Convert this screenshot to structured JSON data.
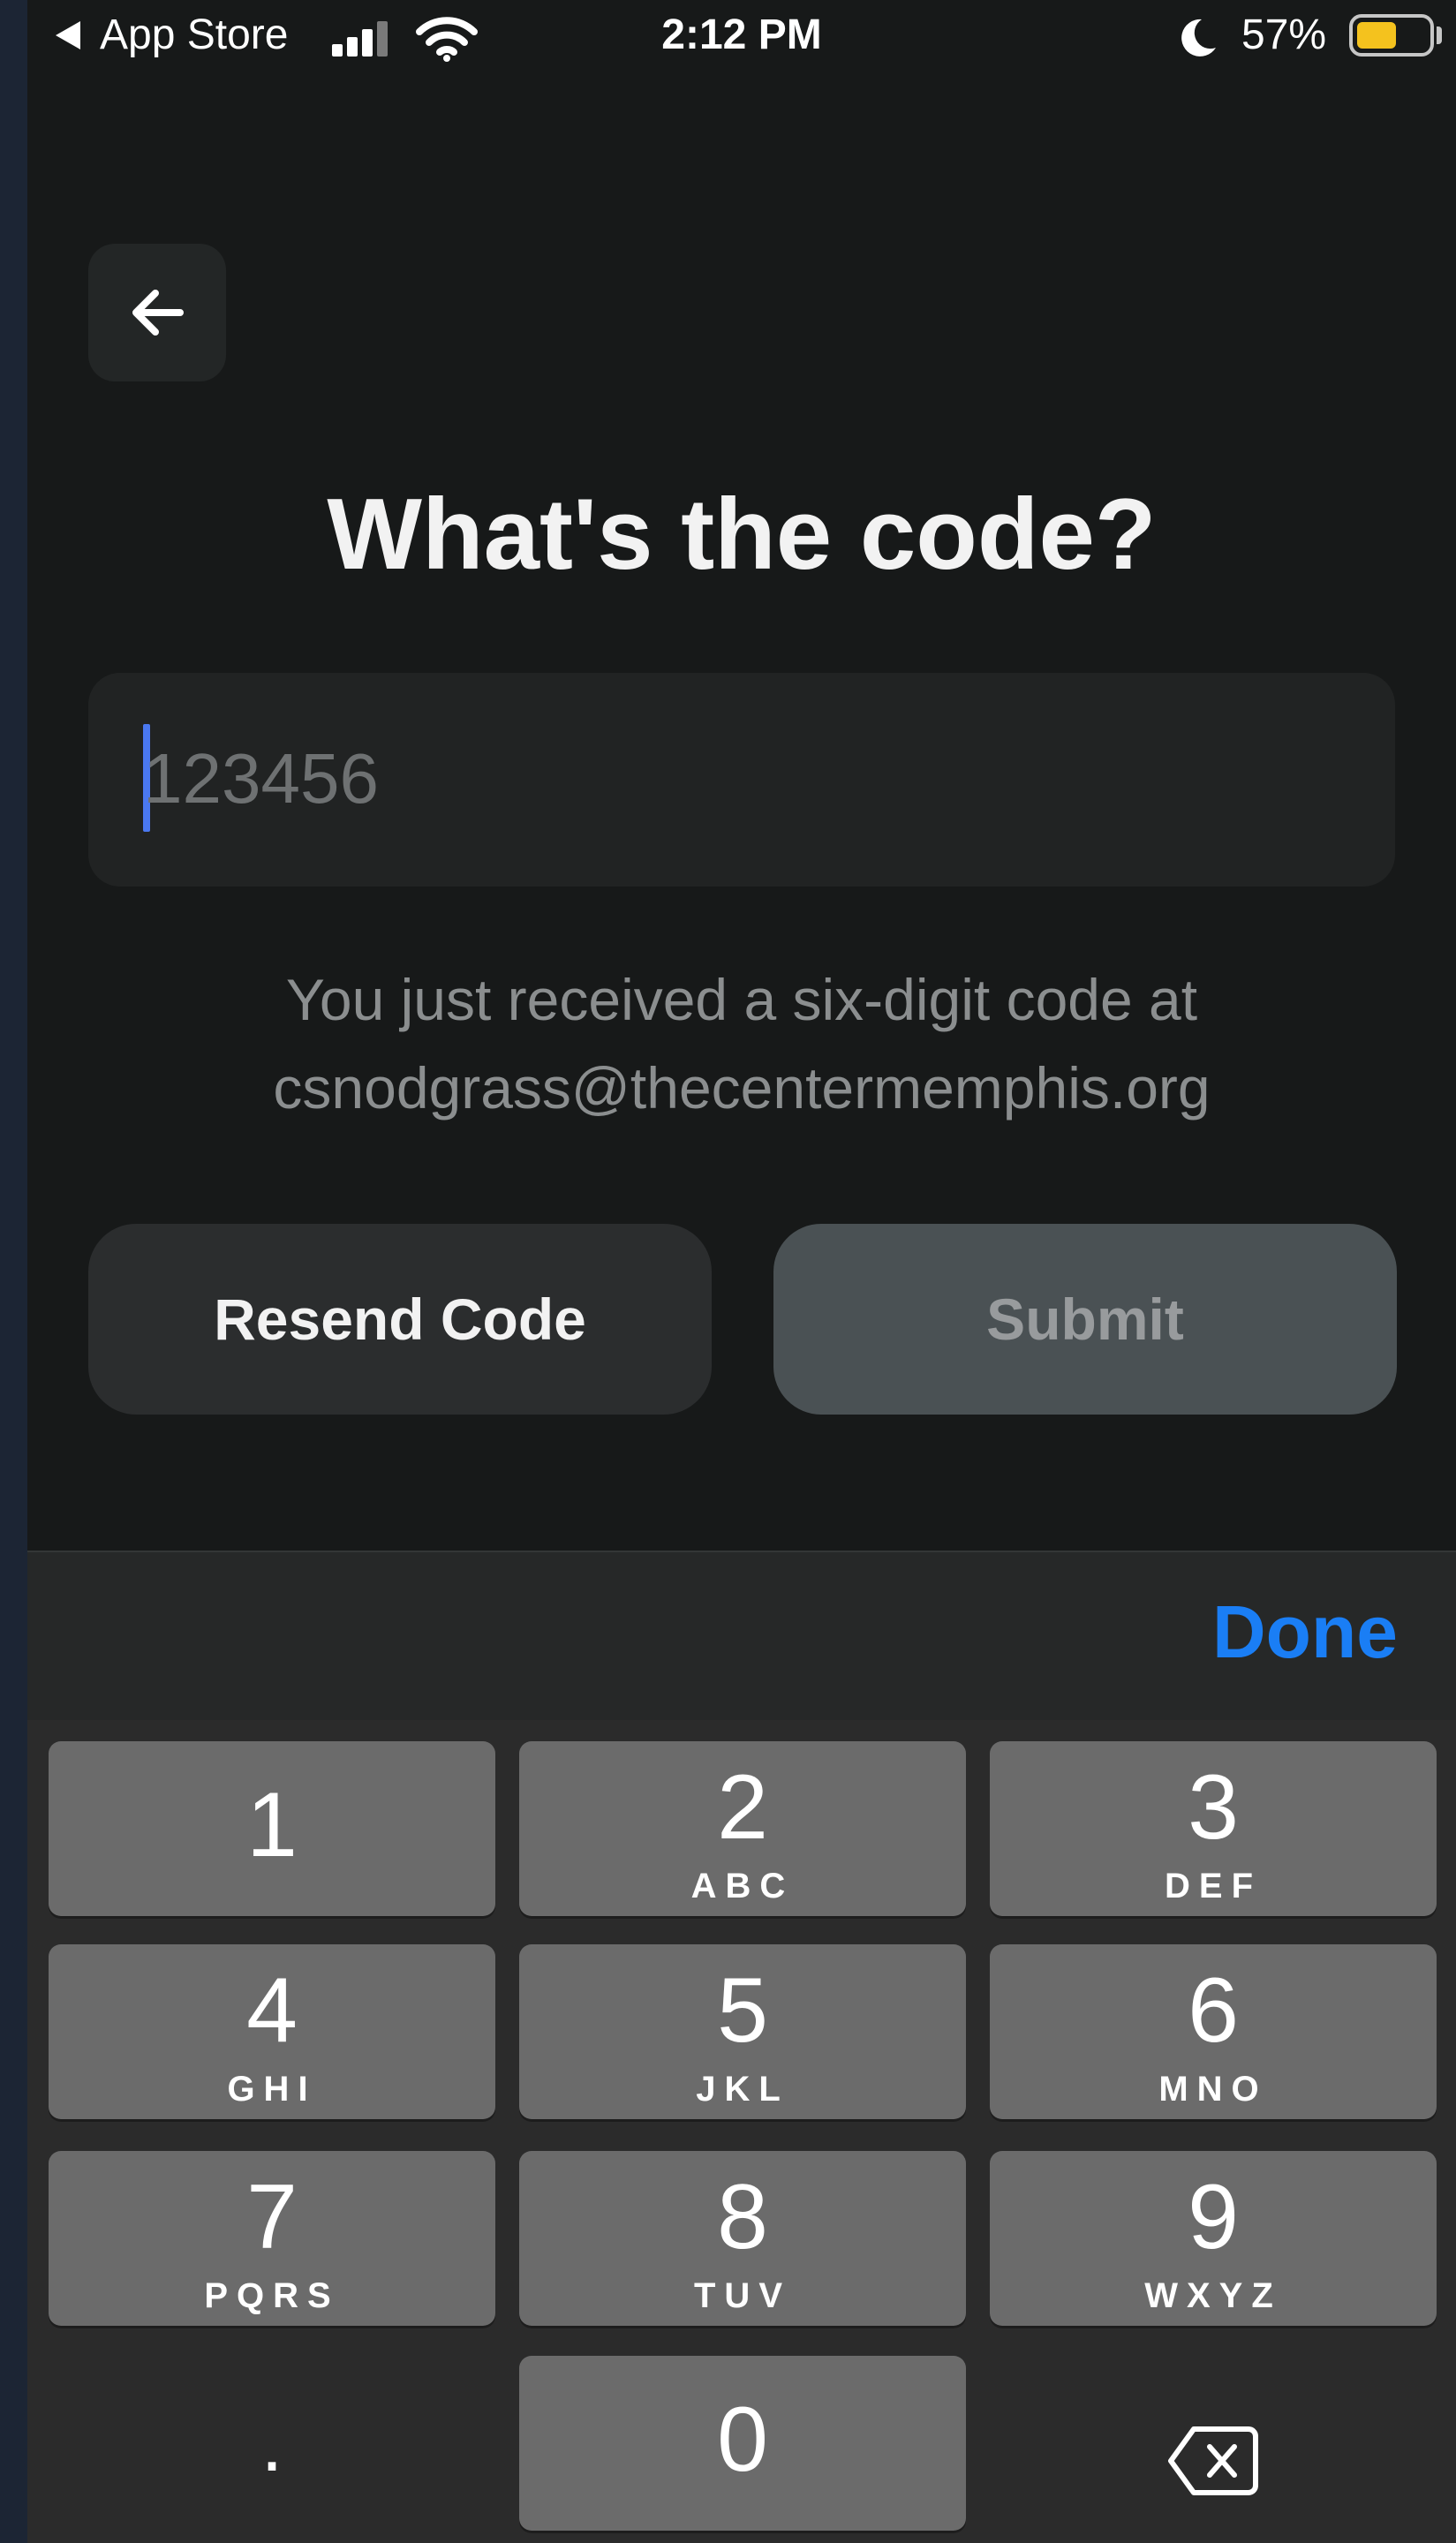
{
  "status_bar": {
    "back_app_label": "App Store",
    "time": "2:12 PM",
    "battery_percent": "57%",
    "battery_level": 0.57,
    "battery_color": "#f4c21e"
  },
  "header": {
    "back_icon": "arrow-left-icon"
  },
  "main": {
    "title": "What's the code?",
    "code_input": {
      "value": "",
      "placeholder": "123456"
    },
    "hint_line1": "You just received a six-digit code at",
    "hint_line2": "csnodgrass@thecentermemphis.org",
    "resend_label": "Resend Code",
    "submit_label": "Submit"
  },
  "keyboard": {
    "done_label": "Done",
    "accent_color": "#1a7ef5",
    "keys": [
      {
        "digit": "1",
        "letters": ""
      },
      {
        "digit": "2",
        "letters": "ABC"
      },
      {
        "digit": "3",
        "letters": "DEF"
      },
      {
        "digit": "4",
        "letters": "GHI"
      },
      {
        "digit": "5",
        "letters": "JKL"
      },
      {
        "digit": "6",
        "letters": "MNO"
      },
      {
        "digit": "7",
        "letters": "PQRS"
      },
      {
        "digit": "8",
        "letters": "TUV"
      },
      {
        "digit": "9",
        "letters": "WXYZ"
      },
      {
        "digit": "0",
        "letters": ""
      }
    ],
    "dot_label": ".",
    "delete_icon": "backspace-icon"
  }
}
